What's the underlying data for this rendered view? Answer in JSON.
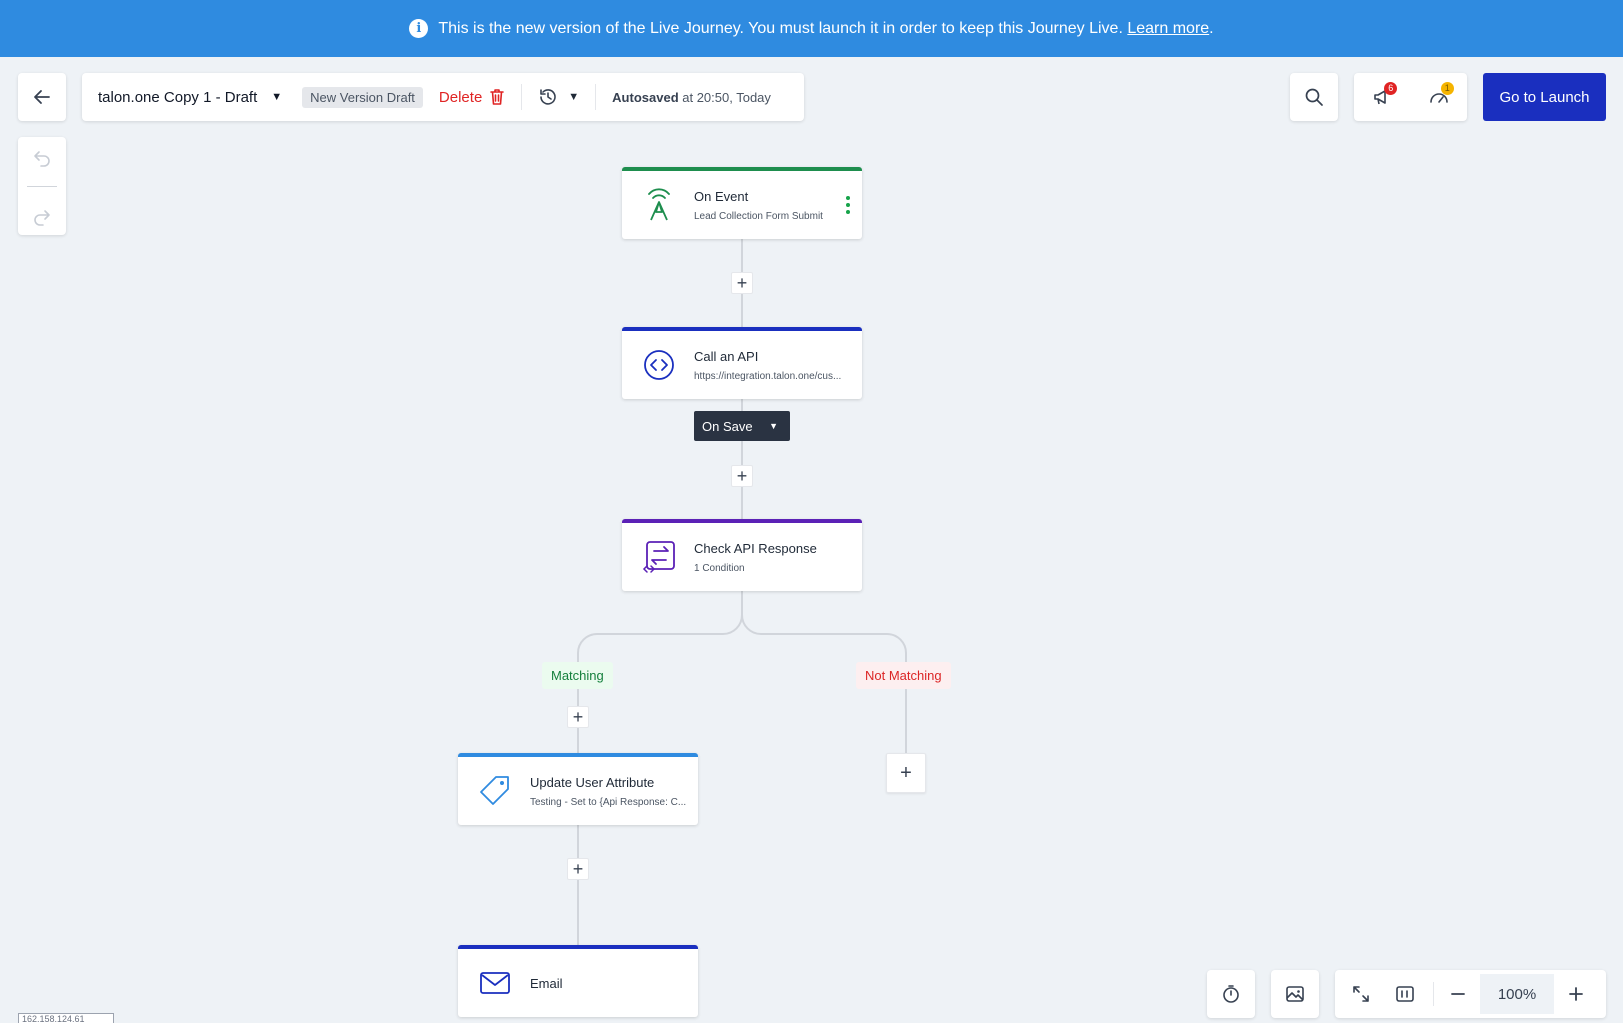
{
  "banner": {
    "message": "This is the new version of the Live Journey. You must launch it in order to keep this Journey Live.",
    "link_text": "Learn more",
    "suffix": ".",
    "background": "#2f8be0"
  },
  "header": {
    "journey_title": "talon.one Copy 1 - Draft",
    "version_badge": "New Version Draft",
    "delete_label": "Delete",
    "autosave_label": "Autosaved",
    "autosave_time": " at 20:50, Today",
    "launch_label": "Go to Launch",
    "notification_count": "6",
    "alert_count": "1"
  },
  "nodes": {
    "on_event": {
      "title": "On Event",
      "subtitle": "Lead Collection Form Submit",
      "accent": "#1e8e4e"
    },
    "call_api": {
      "title": "Call an API",
      "subtitle": "https://integration.talon.one/cus...",
      "accent": "#1a2fbf"
    },
    "check_api": {
      "title": "Check API Response",
      "subtitle": "1 Condition",
      "accent": "#5b21b6"
    },
    "update_attr": {
      "title": "Update User Attribute",
      "subtitle": "Testing - Set to {Api Response: C...",
      "accent": "#2f8be0"
    },
    "email": {
      "title": "Email",
      "accent": "#1a2fbf"
    }
  },
  "on_save": {
    "label": "On Save"
  },
  "branches": {
    "matching": "Matching",
    "not_matching": "Not Matching"
  },
  "zoom": {
    "value": "100%"
  },
  "ip_tag": "162.158.124.61",
  "icons": [
    "back-arrow-icon",
    "undo-icon",
    "redo-icon",
    "chevron-down-icon",
    "trash-icon",
    "history-icon",
    "search-icon",
    "megaphone-icon",
    "gauge-icon",
    "broadcast-icon",
    "code-icon",
    "split-icon",
    "tag-icon",
    "envelope-icon",
    "timer-icon",
    "image-icon",
    "expand-icon",
    "panel-icon",
    "minus-icon",
    "plus-icon"
  ]
}
